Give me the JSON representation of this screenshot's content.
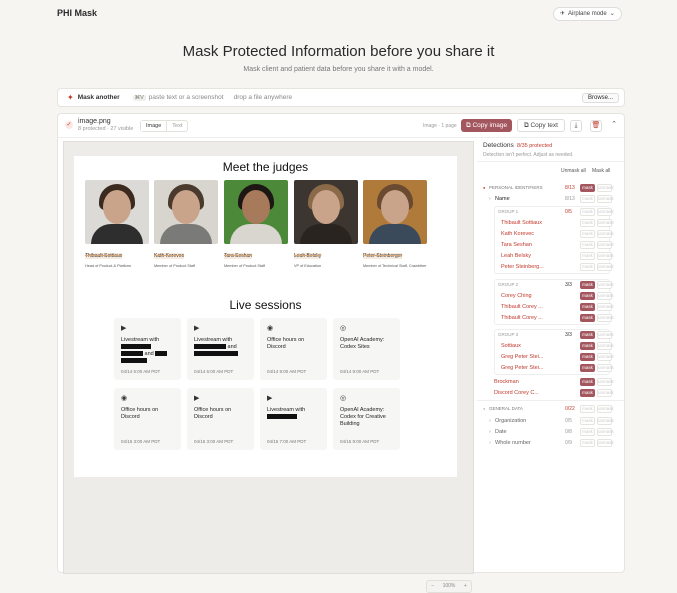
{
  "app": {
    "title": "PHI Mask",
    "airplane_label": "Airplane mode"
  },
  "hero": {
    "title": "Mask Protected Information before you share it",
    "subtitle": "Mask client and patient data before you share it with a model."
  },
  "input_row": {
    "mask_another": "Mask another",
    "shortcut": "⌘V",
    "hint": "paste text or a screenshot",
    "hint2": "drop a file anywhere",
    "browse": "Browse..."
  },
  "file": {
    "name": "image.png",
    "meta": "8 protected · 27 visible",
    "tabs": [
      "Image",
      "Text"
    ],
    "image_meta": "Image · 1 page",
    "copy_image": "Copy image",
    "copy_text": "Copy text",
    "zoom": "100%"
  },
  "slide": {
    "judges_title": "Meet the judges",
    "judges": [
      {
        "name": "Thibault Sottiaux",
        "role": "Head of Product & Platform"
      },
      {
        "name": "Kath Korevec",
        "role": "Member of Product Staff"
      },
      {
        "name": "Tara Seshan",
        "role": "Member of Product Staff"
      },
      {
        "name": "Leah Belsky",
        "role": "VP of Education"
      },
      {
        "name": "Peter Steinberger",
        "role": "Member of Technical Staff, Crawbther"
      }
    ],
    "live_title": "Live sessions",
    "cards": [
      {
        "icon": "▶",
        "title": "Livestream with",
        "date": "04/14 5:00 AM PDT"
      },
      {
        "icon": "▶",
        "title": "Livestream with",
        "date": "04/14 6:00 AM PDT"
      },
      {
        "icon": "◉",
        "title": "Office hours on Discord",
        "date": "04/14 9:00 AM PDT"
      },
      {
        "icon": "◎",
        "title": "OpenAI Academy: Codex Sites",
        "date": "04/14 9:00 AM PDT"
      },
      {
        "icon": "◉",
        "title": "Office hours on Discord",
        "date": "04/15 3:00 AM PDT"
      },
      {
        "icon": "▶",
        "title": "Office hours on Discord",
        "date": "04/15 3:00 AM PDT"
      },
      {
        "icon": "▶",
        "title": "Livestream with",
        "date": "04/15 7:00 AM PDT"
      },
      {
        "icon": "◎",
        "title": "OpenAI Academy: Codex for Creative Building",
        "date": "04/15 9:00 AM PDT"
      }
    ]
  },
  "detections": {
    "title": "Detections",
    "count": "8/35 protected",
    "note": "Detection isn't perfect. Adjust as needed.",
    "unmask_all": "Unmask all",
    "mask_all": "Mask all",
    "pill_on": "mask",
    "pill_off": "mask",
    "pill_unmask": "unmask",
    "personal_label": "PERSONAL IDENTIFIERS",
    "personal_count": "8/13",
    "name_label": "Name",
    "name_count": "8/13",
    "group1_label": "GROUP 1",
    "group1_count": "0/5",
    "group1": [
      "Thibault Sottiaux",
      "Kath Korevec",
      "Tara Seshan",
      "Leah Belsky",
      "Peter Steinberg..."
    ],
    "group2_label": "GROUP 2",
    "group2_count": "3/3",
    "group2": [
      "Corey Ching",
      "Thibault Corey ...",
      "Thibault Corey ..."
    ],
    "group3_label": "GROUP 3",
    "group3_count": "3/3",
    "group3": [
      "Sottiaux",
      "Greg Peter Stei...",
      "Greg Peter Stei..."
    ],
    "extra": [
      "Brockman",
      "Discord Corey C..."
    ],
    "general_label": "GENERAL DATA",
    "general_count": "0/22",
    "general": [
      {
        "label": "Organization",
        "count": "0/5"
      },
      {
        "label": "Date",
        "count": "0/8"
      },
      {
        "label": "Whole number",
        "count": "0/9"
      }
    ]
  }
}
